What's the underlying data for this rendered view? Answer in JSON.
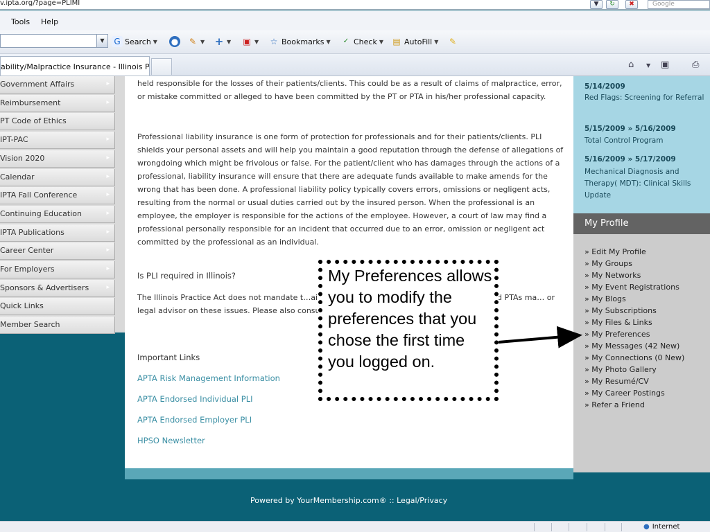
{
  "browser": {
    "url": "v.ipta.org/?page=PLIMI",
    "search_placeholder": "Google",
    "menu": [
      "Tools",
      "Help"
    ],
    "toolbar": {
      "search": "Search",
      "bookmarks": "Bookmarks",
      "check": "Check",
      "autofill": "AutoFill"
    },
    "tab_title": "ability/Malpractice Insurance - Illinois Ph...",
    "status_zone": "Internet"
  },
  "left_nav": [
    "Government Affairs",
    "Reimbursement",
    "PT Code of Ethics",
    "IPT-PAC",
    "Vision 2020",
    "Calendar",
    "IPTA Fall Conference",
    "Continuing Education",
    "IPTA Publications",
    "Career Center",
    "For Employers",
    "Sponsors & Advertisers",
    "Quick Links",
    "Member Search"
  ],
  "content": {
    "para1": "held responsible for the losses of their patients/clients. This could be as a result of claims of malpractice, error, or mistake committed or alleged to have been committed by the PT or PTA in his/her professional capacity.",
    "para2": "Professional liability insurance is one form of protection for professionals and for their patients/clients. PLI shields your personal assets and will help you maintain a good reputation through the defense of allegations of wrongdoing which might be frivolous or false. For the patient/client who has damages through the actions of a professional, liability insurance will ensure that there are adequate funds available to make amends for the wrong that has been done. A professional liability policy typically covers errors, omissions or negligent acts, resulting from the normal or usual duties carried out by the insured person. When the professional is an employee, the employer is responsible for the actions of the employee. However, a court of law may find a professional personally responsible for an incident that occurred due to an error, omission or negligent act committed by the professional as an individual.",
    "question": "Is PLI required in Illinois?",
    "para3": "The Illinois Practice Act does not mandate t…ain employers may require that individual PTs and PTAs ma… or legal advisor on these issues. Please also consult …o obtain more information on PLI.",
    "important_links_heading": "Important Links",
    "links": [
      "APTA Risk Management Information",
      "APTA Endorsed Individual PLI",
      "APTA Endorsed Employer PLI",
      "HPSO Newsletter"
    ]
  },
  "events": [
    {
      "date": "5/14/2009",
      "title": "Red Flags: Screening for Referral"
    },
    {
      "date": "5/15/2009 » 5/16/2009",
      "title": "Total Control Program"
    },
    {
      "date": "5/16/2009 » 5/17/2009",
      "title": "Mechanical Diagnosis and Therapy( MDT): Clinical Skills Update"
    }
  ],
  "profile": {
    "header": "My Profile",
    "items": [
      "» Edit My Profile",
      "» My Groups",
      "» My Networks",
      "» My Event Registrations",
      "» My Blogs",
      "» My Subscriptions",
      "» My Files & Links",
      "» My Preferences",
      "» My Messages (42 New)",
      "» My Connections (0 New)",
      "» My Photo Gallery",
      "» My Resumé/CV",
      "» My Career Postings",
      "» Refer a Friend"
    ]
  },
  "footer": "Powered by YourMembership.com®  ::  Legal/Privacy",
  "callout": "My Preferences allows you to modify the preferences that you chose the first time you logged on.",
  "colors": {
    "page_bg": "#0b6176",
    "events_bg": "#a6d6e4",
    "profile_header": "#636363",
    "link": "#3b8fa4"
  }
}
